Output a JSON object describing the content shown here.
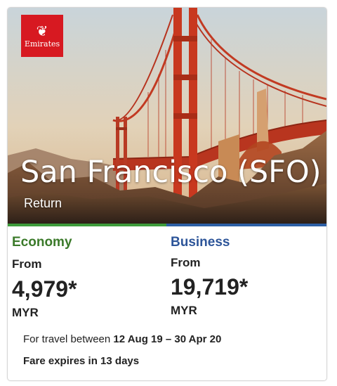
{
  "brand": {
    "logo_text": "Emirates",
    "logo_color": "#d71921"
  },
  "destination": {
    "title": "San Francisco (SFO)",
    "trip_type": "Return"
  },
  "fares": {
    "economy": {
      "cabin": "Economy",
      "from_label": "From",
      "price": "4,979*",
      "currency": "MYR",
      "color": "#3b7a2a"
    },
    "business": {
      "cabin": "Business",
      "from_label": "From",
      "price": "19,719*",
      "currency": "MYR",
      "color": "#2d5599"
    }
  },
  "travel": {
    "prefix": "For travel between ",
    "dates": "12 Aug 19 – 30 Apr 20"
  },
  "expiry": "Fare expires in 13 days"
}
